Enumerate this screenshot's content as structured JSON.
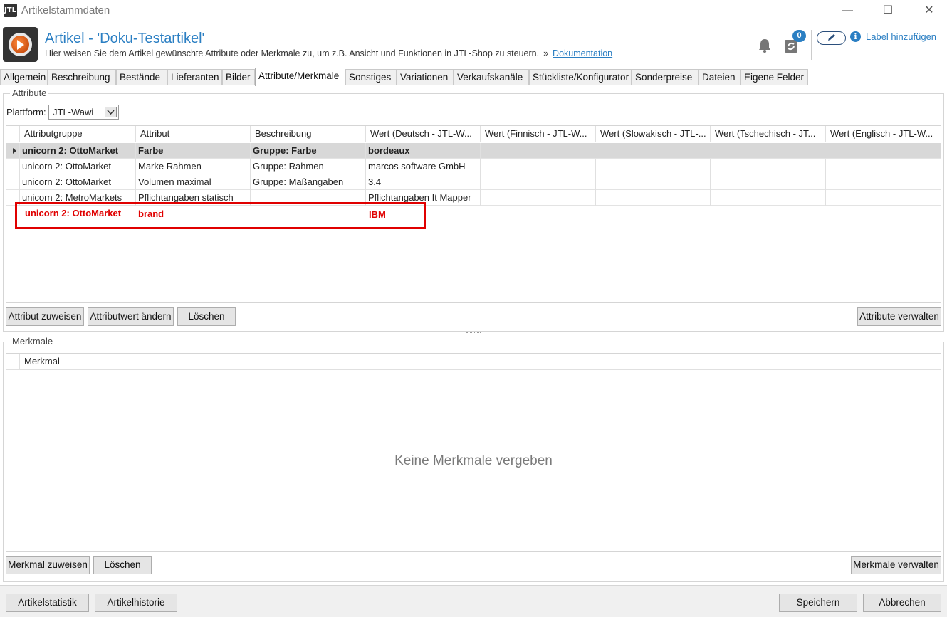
{
  "window": {
    "logo": "JTL",
    "title": "Artikelstammdaten",
    "minimize": "—",
    "maximize": "☐",
    "close": "✕"
  },
  "header": {
    "title": "Artikel - 'Doku-Testartikel'",
    "subtitle": "Hier weisen Sie dem Artikel gewünschte Attribute oder Merkmale zu, um z.B. Ansicht und Funktionen in JTL-Shop zu steuern.",
    "separator": "»",
    "doc_link": "Dokumentation",
    "sync_count": "0",
    "info_glyph": "i",
    "label_link": "Label hinzufügen"
  },
  "tabs": [
    {
      "label": "Allgemein",
      "active": false
    },
    {
      "label": "Beschreibung",
      "active": false
    },
    {
      "label": "Bestände",
      "active": false
    },
    {
      "label": "Lieferanten",
      "active": false
    },
    {
      "label": "Bilder",
      "active": false
    },
    {
      "label": "Attribute/Merkmale",
      "active": true
    },
    {
      "label": "Sonstiges",
      "active": false
    },
    {
      "label": "Variationen",
      "active": false
    },
    {
      "label": "Verkaufskanäle",
      "active": false
    },
    {
      "label": "Stückliste/Konfigurator",
      "active": false
    },
    {
      "label": "Sonderpreise",
      "active": false
    },
    {
      "label": "Dateien",
      "active": false
    },
    {
      "label": "Eigene Felder",
      "active": false
    }
  ],
  "attribute": {
    "group_label": "Attribute",
    "plattform_label": "Plattform:",
    "plattform_value": "JTL-Wawi",
    "columns": [
      "Attributgruppe",
      "Attribut",
      "Beschreibung",
      "Wert (Deutsch - JTL-W...",
      "Wert (Finnisch - JTL-W...",
      "Wert (Slowakisch - JTL-...",
      "Wert (Tschechisch - JT...",
      "Wert (Englisch - JTL-W..."
    ],
    "rows": [
      {
        "gruppe": "unicorn 2: OttoMarket",
        "attribut": "Farbe",
        "beschreibung": "Gruppe: Farbe",
        "wert_de": "bordeaux",
        "selected": true
      },
      {
        "gruppe": "unicorn 2: OttoMarket",
        "attribut": "Marke Rahmen",
        "beschreibung": "Gruppe: Rahmen",
        "wert_de": "marcos software GmbH",
        "selected": false
      },
      {
        "gruppe": "unicorn 2: OttoMarket",
        "attribut": "Volumen maximal",
        "beschreibung": "Gruppe: Maßangaben",
        "wert_de": "3.4",
        "selected": false
      },
      {
        "gruppe": "unicorn 2: MetroMarkets",
        "attribut": "Pflichtangaben statisch",
        "beschreibung": "",
        "wert_de": "Pflichtangaben It Mapper",
        "selected": false
      }
    ],
    "highlight": {
      "gruppe": "unicorn 2: OttoMarket",
      "attribut": "brand",
      "wert_de": "IBM"
    },
    "buttons": {
      "assign": "Attribut zuweisen",
      "change_value": "Attributwert ändern",
      "delete": "Löschen",
      "manage": "Attribute verwalten"
    }
  },
  "merkmale": {
    "group_label": "Merkmale",
    "column": "Merkmal",
    "empty_text": "Keine Merkmale vergeben",
    "buttons": {
      "assign": "Merkmal zuweisen",
      "delete": "Löschen",
      "manage": "Merkmale verwalten"
    }
  },
  "footer": {
    "statistik": "Artikelstatistik",
    "historie": "Artikelhistorie",
    "save": "Speichern",
    "cancel": "Abbrechen"
  },
  "colors": {
    "accent": "#2b7fc3",
    "highlight": "#e00000",
    "selected_row": "#d8d8d8"
  }
}
